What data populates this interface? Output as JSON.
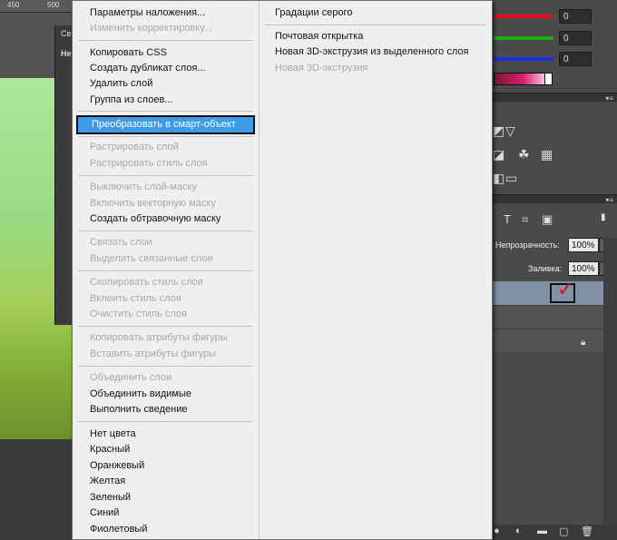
{
  "ruler": {
    "marks": [
      "450",
      "500"
    ]
  },
  "dialog": {
    "tab1": "Св",
    "tab2": "Не"
  },
  "color_panel": {
    "sliders": [
      {
        "name": "red",
        "color": "#e01020",
        "value": "0"
      },
      {
        "name": "green",
        "color": "#18b018",
        "value": "0"
      },
      {
        "name": "blue",
        "color": "#1830e0",
        "value": "0"
      }
    ]
  },
  "layers_panel": {
    "opacity_label": "Непрозрачность:",
    "opacity_value": "100%",
    "fill_label": "Заливка:",
    "fill_value": "100%"
  },
  "context_menu": {
    "left": [
      {
        "label": "Параметры наложения...",
        "disabled": false
      },
      {
        "label": "Изменить корректировку...",
        "disabled": true
      },
      {
        "label": "Копировать CSS",
        "disabled": false
      },
      {
        "label": "Создать дубликат слоя...",
        "disabled": false
      },
      {
        "label": "Удалить слой",
        "disabled": false
      },
      {
        "label": "Группа из слоев...",
        "disabled": false
      },
      {
        "label": "Преобразовать в смарт-объект",
        "disabled": false,
        "selected": true
      },
      {
        "label": "Растрировать слой",
        "disabled": true
      },
      {
        "label": "Растрировать стиль слоя",
        "disabled": true
      },
      {
        "label": "Выключить слой-маску",
        "disabled": true
      },
      {
        "label": "Включить векторную маску",
        "disabled": true
      },
      {
        "label": "Создать обтравочную маску",
        "disabled": false
      },
      {
        "label": "Связать слои",
        "disabled": true
      },
      {
        "label": "Выделить связанные слои",
        "disabled": true
      },
      {
        "label": "Скопировать стиль слоя",
        "disabled": true
      },
      {
        "label": "Вклеить стиль слоя",
        "disabled": true
      },
      {
        "label": "Очистить стиль слоя",
        "disabled": true
      },
      {
        "label": "Копировать атрибуты фигуры",
        "disabled": true
      },
      {
        "label": "Вставить атрибуты фигуры",
        "disabled": true
      },
      {
        "label": "Объединить слои",
        "disabled": true
      },
      {
        "label": "Объединить видимые",
        "disabled": false
      },
      {
        "label": "Выполнить сведение",
        "disabled": false
      },
      {
        "label": "Нет цвета",
        "disabled": false
      },
      {
        "label": "Красный",
        "disabled": false
      },
      {
        "label": "Оранжевый",
        "disabled": false
      },
      {
        "label": "Желтая",
        "disabled": false
      },
      {
        "label": "Зеленый",
        "disabled": false
      },
      {
        "label": "Синий",
        "disabled": false
      },
      {
        "label": "Фиолетовый",
        "disabled": false
      }
    ],
    "right": [
      {
        "label": "Градации серого",
        "disabled": false
      },
      {
        "label": "Почтовая открытка",
        "disabled": false
      },
      {
        "label": "Новая 3D-экструзия из выделенного слоя",
        "disabled": false
      },
      {
        "label": "Новая 3D-экструзия",
        "disabled": true
      }
    ]
  },
  "colors": {
    "highlight": "#3f9be8",
    "menu_bg": "#efefef",
    "workspace": "#3c3c3c"
  }
}
